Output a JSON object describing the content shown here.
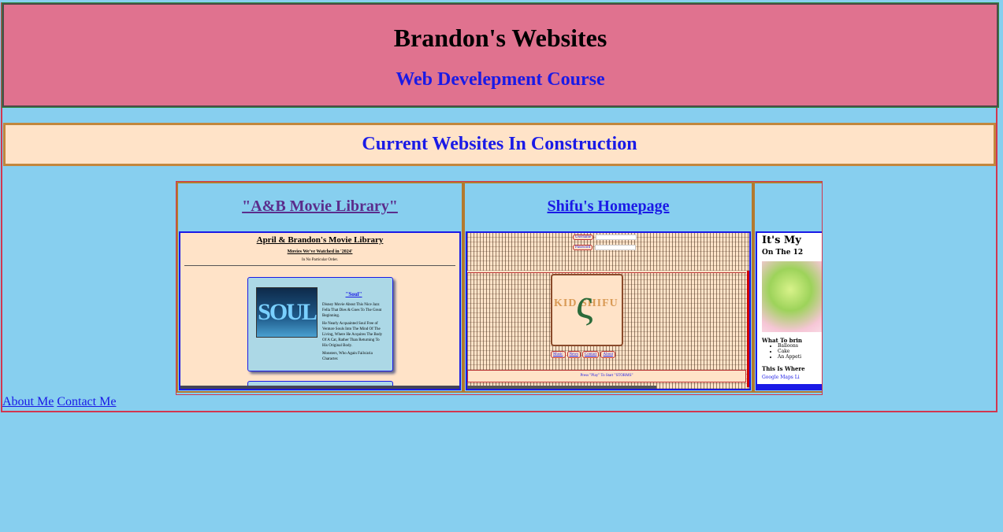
{
  "header": {
    "title": "Brandon's Websites",
    "subtitle": "Web Develepment Course"
  },
  "section": {
    "heading": "Current Websites In Construction"
  },
  "gallery": {
    "cards": [
      {
        "title": "\"A&B Movie Library\"",
        "preview": {
          "page_title": "April & Brandon's Movie Library",
          "subheading": "Movies We've Watched in '2024'",
          "note": "In No Particular Order.",
          "poster_text": "SOUL",
          "movie_title": "\"Soul\"",
          "movie_desc": "Disney Movie About This Nice Jazz Fella That Dies & Goes To The Great Beginning.",
          "movie_desc2": "He Nearly Acquainted Soul Free of Venture Souls Into The Mind Of The Living, Where He Acquires The Body Of A Cat, Rather Than Returning To His Original Body.",
          "movie_desc3": "Monsters, Who Again Fails/aria Character."
        }
      },
      {
        "title": "Shifu's Homepage",
        "preview": {
          "username_label": "Username",
          "password_label": "Password",
          "logo_text": "KID SHIFU",
          "nav": [
            "Music",
            "News",
            "Contact",
            "About"
          ],
          "footer_text": "Press \"Play\" To Start \"STORMS\""
        }
      },
      {
        "title": "",
        "preview": {
          "heading": "It's My",
          "subheading": "On The 12",
          "what_heading": "What To brin",
          "items": [
            "Balloons",
            "Cake",
            "An Appeti"
          ],
          "where_heading": "This Is Where",
          "maps_link": "Google Maps Li"
        }
      }
    ]
  },
  "footer": {
    "about": "About Me",
    "contact": "Contact Me"
  }
}
